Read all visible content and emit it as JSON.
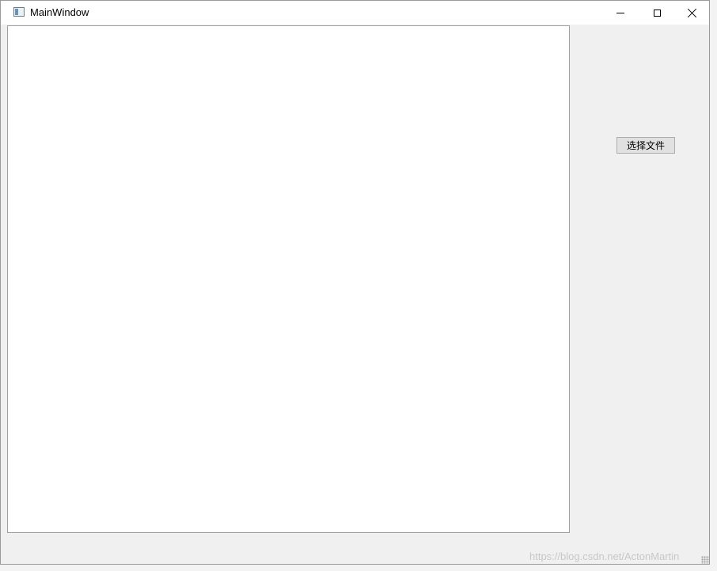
{
  "window": {
    "title": "MainWindow",
    "icon": "app-window-icon",
    "controls": {
      "minimize": "minimize-icon",
      "maximize": "maximize-icon",
      "close": "close-icon"
    }
  },
  "main": {
    "select_file_button": "选择文件"
  },
  "watermark": "https://blog.csdn.net/ActonMartin",
  "colors": {
    "window_bg": "#f0f0f0",
    "titlebar_bg": "#ffffff",
    "canvas_bg": "#ffffff",
    "canvas_border": "#a0a0a0",
    "button_bg": "#e1e1e1"
  }
}
